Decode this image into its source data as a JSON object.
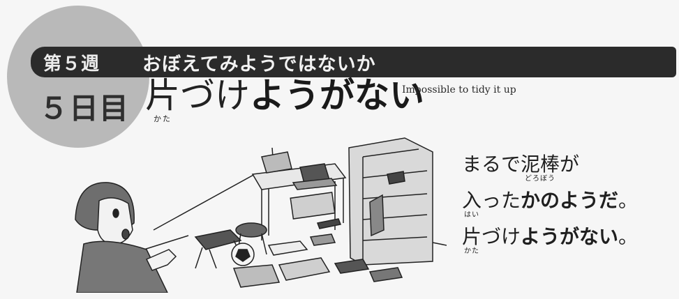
{
  "header": {
    "week_label": "第５週",
    "week_title": "おぼえてみようではないか",
    "day_label": "５日目"
  },
  "lesson": {
    "title_kanji": "片",
    "title_kanji_reading": "かた",
    "title_light": "づけ",
    "title_bold": "ようがない",
    "subtitle_en": "Impossible to tidy it up"
  },
  "caption": {
    "line1_plain": "まるで",
    "line1_kanji": "泥棒",
    "line1_kanji_reading": "どろぼう",
    "line1_tail": "が",
    "line2_kanji": "入",
    "line2_kanji_reading": "はい",
    "line2_plain": "った",
    "line2_bold": "かのようだ",
    "line2_end": "。",
    "line3_kanji": "片",
    "line3_kanji_reading": "かた",
    "line3_plain": "づけ",
    "line3_bold": "ようがない",
    "line3_end": "。"
  },
  "colors": {
    "circle": "#b9b9b9",
    "bar": "#2b2b2b",
    "background": "#f6f6f6"
  }
}
